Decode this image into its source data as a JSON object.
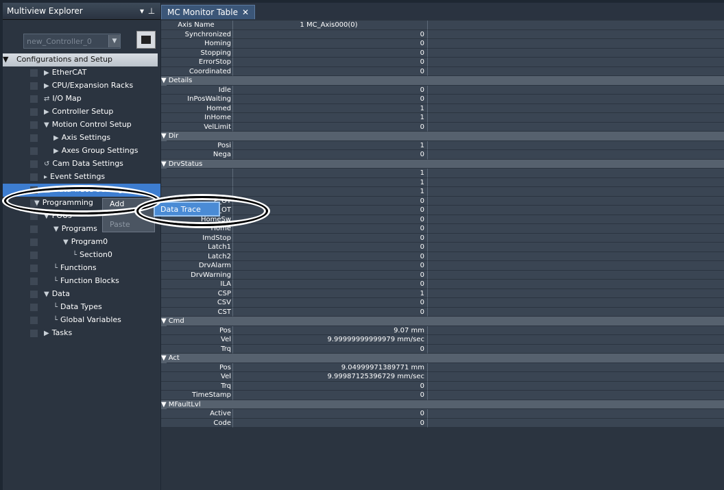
{
  "explorer": {
    "title": "Multiview Explorer",
    "controller": "new_Controller_0",
    "tree": [
      {
        "label": "Configurations and Setup",
        "level": 0,
        "kind": "section"
      },
      {
        "label": "EtherCAT",
        "level": 1
      },
      {
        "label": "CPU/Expansion Racks",
        "level": 1
      },
      {
        "label": "I/O Map",
        "level": 1
      },
      {
        "label": "Controller Setup",
        "level": 1
      },
      {
        "label": "Motion Control Setup",
        "level": 1
      },
      {
        "label": "Axis Settings",
        "level": 2
      },
      {
        "label": "Axes Group Settings",
        "level": 2
      },
      {
        "label": "Cam Data Settings",
        "level": 1
      },
      {
        "label": "Event Settings",
        "level": 1
      },
      {
        "label": "Data Trace Settings",
        "level": 1,
        "selected": true
      },
      {
        "label": "Programming",
        "level": 0
      },
      {
        "label": "POUs",
        "level": 1
      },
      {
        "label": "Programs",
        "level": 2
      },
      {
        "label": "Program0",
        "level": 3
      },
      {
        "label": "Section0",
        "level": 4
      },
      {
        "label": "Functions",
        "level": 2
      },
      {
        "label": "Function Blocks",
        "level": 2
      },
      {
        "label": "Data",
        "level": 1
      },
      {
        "label": "Data Types",
        "level": 2
      },
      {
        "label": "Global Variables",
        "level": 2
      },
      {
        "label": "Tasks",
        "level": 1
      }
    ]
  },
  "context_menu": {
    "items": [
      "Add",
      "Paste"
    ],
    "submenu": "Data Trace"
  },
  "monitor": {
    "tab": "MC Monitor Table",
    "header": {
      "name": "Axis Name",
      "value": "1 MC_Axis000(0)"
    },
    "rows": [
      {
        "name": "Synchronized",
        "value": "0"
      },
      {
        "name": "Homing",
        "value": "0"
      },
      {
        "name": "Stopping",
        "value": "0"
      },
      {
        "name": "ErrorStop",
        "value": "0"
      },
      {
        "name": "Coordinated",
        "value": "0"
      },
      {
        "group": "Details"
      },
      {
        "name": "Idle",
        "value": "0"
      },
      {
        "name": "InPosWaiting",
        "value": "0"
      },
      {
        "name": "Homed",
        "value": "1"
      },
      {
        "name": "InHome",
        "value": "1"
      },
      {
        "name": "VelLimit",
        "value": "0"
      },
      {
        "group": "Dir"
      },
      {
        "name": "Posi",
        "value": "1"
      },
      {
        "name": "Nega",
        "value": "0"
      },
      {
        "group": "DrvStatus"
      },
      {
        "name": "",
        "value": "1"
      },
      {
        "name": "",
        "value": "1"
      },
      {
        "name": "",
        "value": "1"
      },
      {
        "name": "P_OT",
        "value": "0"
      },
      {
        "name": "N_OT",
        "value": "0"
      },
      {
        "name": "HomeSw",
        "value": "0"
      },
      {
        "name": "Home",
        "value": "0"
      },
      {
        "name": "ImdStop",
        "value": "0"
      },
      {
        "name": "Latch1",
        "value": "0"
      },
      {
        "name": "Latch2",
        "value": "0"
      },
      {
        "name": "DrvAlarm",
        "value": "0"
      },
      {
        "name": "DrvWarning",
        "value": "0"
      },
      {
        "name": "ILA",
        "value": "0"
      },
      {
        "name": "CSP",
        "value": "1"
      },
      {
        "name": "CSV",
        "value": "0"
      },
      {
        "name": "CST",
        "value": "0"
      },
      {
        "group": "Cmd"
      },
      {
        "name": "Pos",
        "value": "9.07 mm"
      },
      {
        "name": "Vel",
        "value": "9.99999999999979 mm/sec"
      },
      {
        "name": "Trq",
        "value": "0"
      },
      {
        "group": "Act"
      },
      {
        "name": "Pos",
        "value": "9.04999971389771 mm"
      },
      {
        "name": "Vel",
        "value": "9.99987125396729 mm/sec"
      },
      {
        "name": "Trq",
        "value": "0"
      },
      {
        "name": "TimeStamp",
        "value": "0"
      },
      {
        "group": "MFaultLvl"
      },
      {
        "name": "Active",
        "value": "0"
      },
      {
        "name": "Code",
        "value": "0"
      }
    ]
  }
}
